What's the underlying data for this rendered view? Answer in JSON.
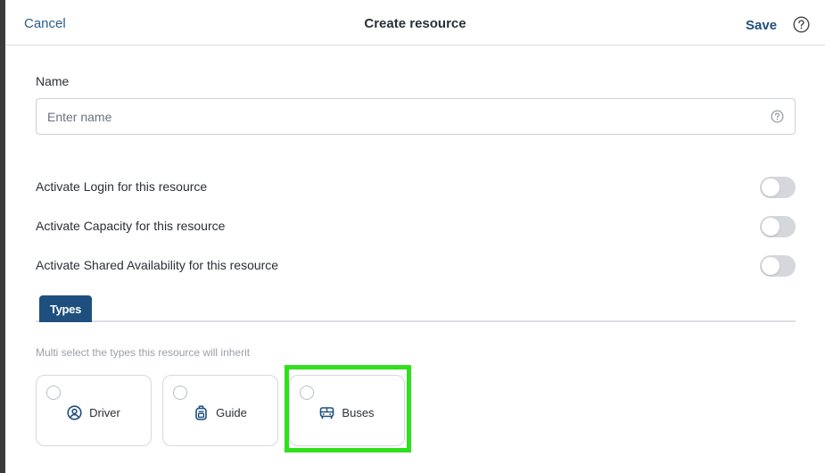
{
  "header": {
    "cancel_label": "Cancel",
    "title": "Create resource",
    "save_label": "Save"
  },
  "form": {
    "name_label": "Name",
    "name_placeholder": "Enter name",
    "name_value": ""
  },
  "toggles": [
    {
      "label": "Activate Login for this resource",
      "on": false
    },
    {
      "label": "Activate Capacity for this resource",
      "on": false
    },
    {
      "label": "Activate Shared Availability for this resource",
      "on": false
    }
  ],
  "tabs": [
    {
      "label": "Types",
      "active": true
    }
  ],
  "types": {
    "hint": "Multi select the types this resource will inherit",
    "items": [
      {
        "label": "Driver",
        "icon": "user-circle-icon",
        "selected": false
      },
      {
        "label": "Guide",
        "icon": "backpack-icon",
        "selected": false
      },
      {
        "label": "Buses",
        "icon": "bus-icon",
        "selected": false
      }
    ]
  },
  "colors": {
    "accent": "#1e4f7e",
    "link": "#2a5d8c",
    "toggle_off": "#d4d7dc",
    "highlight": "#2fe01c"
  }
}
